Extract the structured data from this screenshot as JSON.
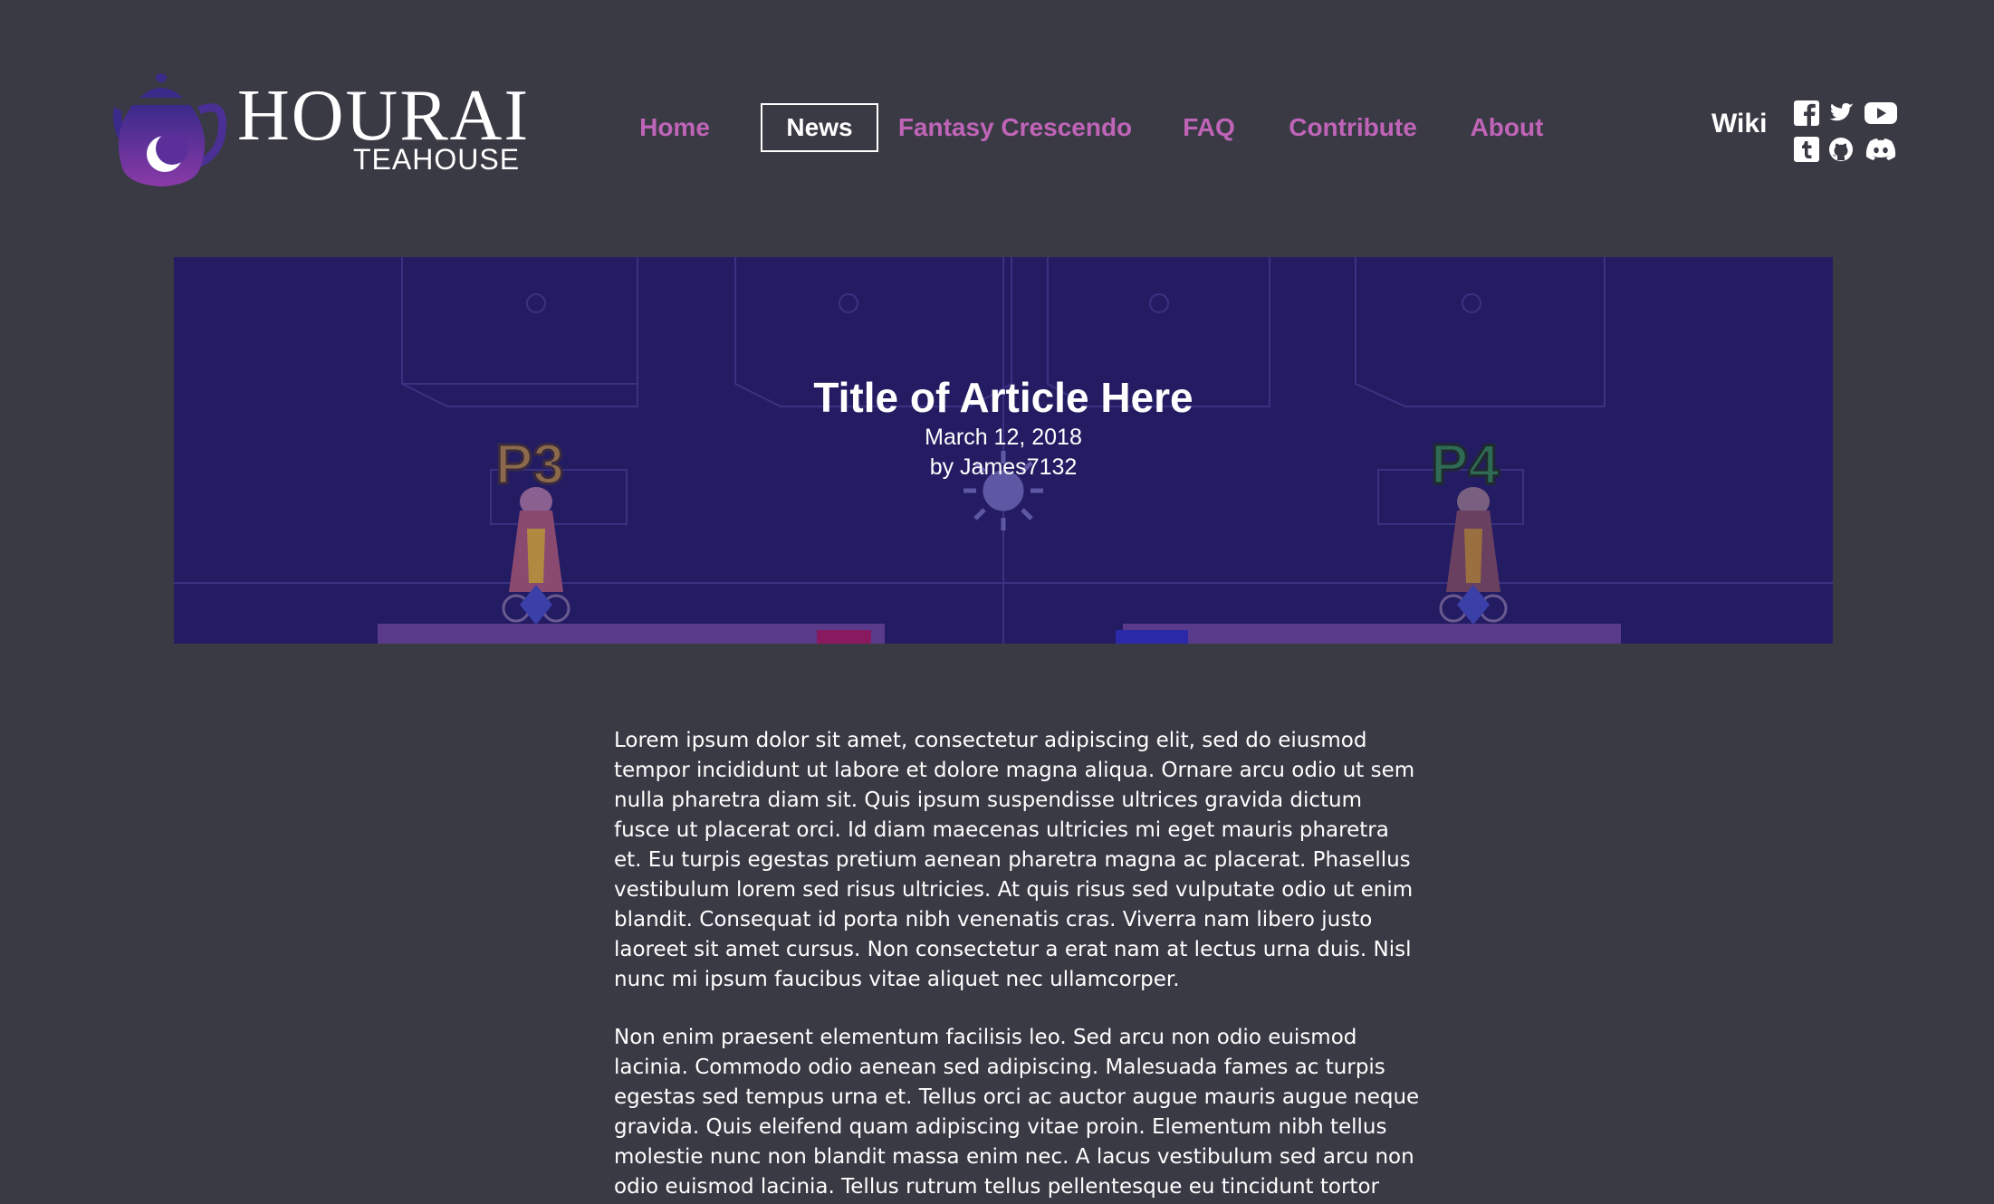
{
  "brand": {
    "title": "HOURAI",
    "subtitle": "TEAHOUSE",
    "colors": {
      "purple": "#7b3fb0",
      "blue": "#3a2a8a",
      "accent": "#c064b8"
    }
  },
  "nav": {
    "items": [
      {
        "label": "Home",
        "active": false
      },
      {
        "label": "News",
        "active": true
      },
      {
        "label": "Fantasy Crescendo",
        "active": false
      },
      {
        "label": "FAQ",
        "active": false
      },
      {
        "label": "Contribute",
        "active": false
      },
      {
        "label": "About",
        "active": false
      }
    ],
    "wiki_label": "Wiki",
    "social_icons": [
      "facebook-icon",
      "twitter-icon",
      "youtube-icon",
      "tumblr-icon",
      "github-icon",
      "discord-icon"
    ]
  },
  "hero": {
    "title": "Title of Article Here",
    "date": "March 12, 2018",
    "author": "by James7132",
    "labels": {
      "p3": "P3",
      "p4": "P4"
    },
    "background_color": "#241c63"
  },
  "article": {
    "paragraphs": [
      "Lorem ipsum dolor sit amet, consectetur adipiscing elit, sed do eiusmod tempor incididunt ut labore et dolore magna aliqua. Ornare arcu odio ut sem nulla pharetra diam sit. Quis ipsum suspendisse ultrices gravida dictum fusce ut placerat orci. Id diam maecenas ultricies mi eget mauris pharetra et. Eu turpis egestas pretium aenean pharetra magna ac placerat. Phasellus vestibulum lorem sed risus ultricies. At quis risus sed vulputate odio ut enim blandit. Consequat id porta nibh venenatis cras. Viverra nam libero justo laoreet sit amet cursus. Non consectetur a erat nam at lectus urna duis. Nisl nunc mi ipsum faucibus vitae aliquet nec ullamcorper.",
      "Non enim praesent elementum facilisis leo. Sed arcu non odio euismod lacinia. Commodo odio aenean sed adipiscing. Malesuada fames ac turpis egestas sed tempus urna et. Tellus orci ac auctor augue mauris augue neque gravida. Quis eleifend quam adipiscing vitae proin. Elementum nibh tellus molestie nunc non blandit massa enim nec. A lacus vestibulum sed arcu non odio euismod lacinia. Tellus rutrum tellus pellentesque eu tincidunt tortor aliquam nulla."
    ]
  }
}
